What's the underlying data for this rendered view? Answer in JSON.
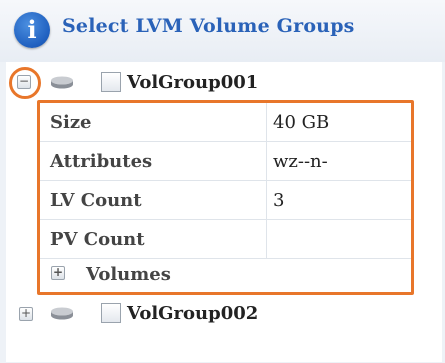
{
  "header": {
    "title": "Select LVM Volume Groups",
    "info_icon": "info-icon"
  },
  "tree": {
    "groups": [
      {
        "label": "VolGroup001",
        "expanded": true,
        "checked": false,
        "icon": "disk-icon"
      },
      {
        "label": "VolGroup002",
        "expanded": false,
        "checked": false,
        "icon": "disk-icon"
      }
    ],
    "details": [
      {
        "key": "Size",
        "value": "40 GB"
      },
      {
        "key": "Attributes",
        "value": "wz--n-"
      },
      {
        "key": "LV Count",
        "value": "3"
      },
      {
        "key": "PV Count",
        "value": ""
      }
    ],
    "volumes_label": "Volumes",
    "toggle_collapse": "−",
    "toggle_expand": "+"
  },
  "colors": {
    "accent_orange": "#e8762a",
    "title_blue": "#2a62b8",
    "info_blue": "#1f5fbf"
  }
}
